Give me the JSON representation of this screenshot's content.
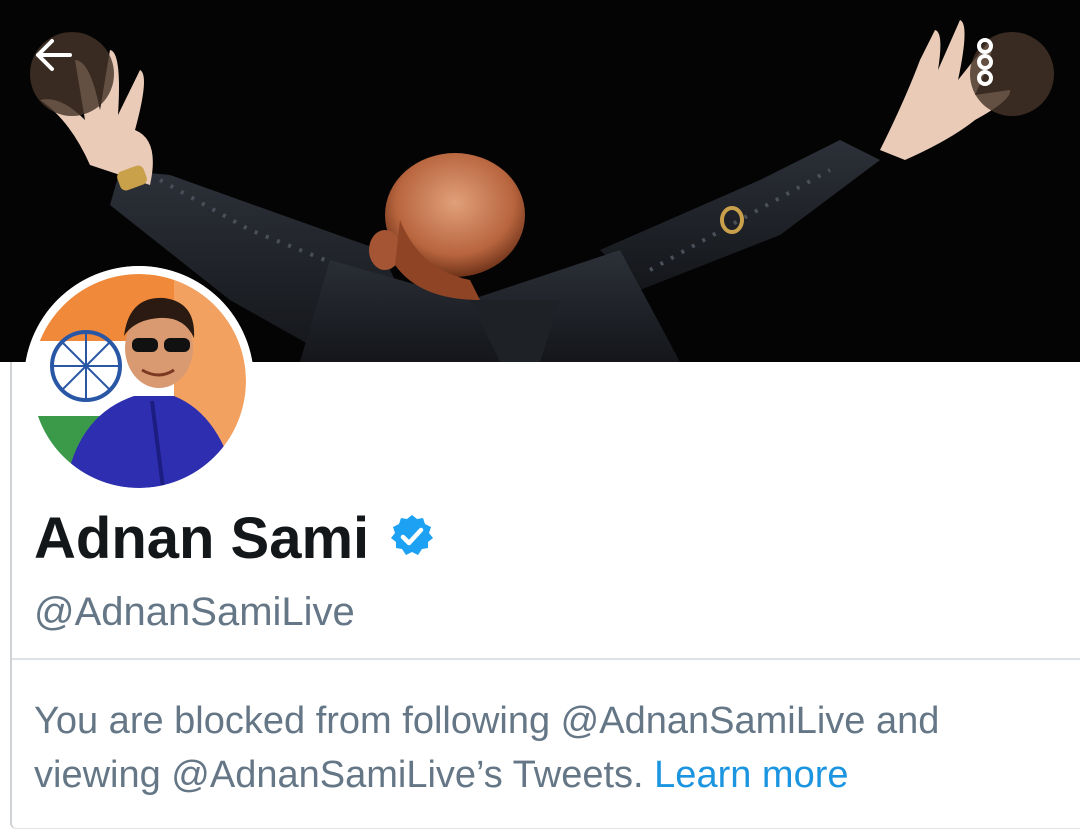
{
  "header": {
    "back_icon": "arrow-left-icon",
    "more_icon": "vertical-ellipsis-icon",
    "nav_button_color": "#46342a"
  },
  "profile": {
    "name": "Adnan Sami",
    "verified_icon": "verified-badge-icon",
    "verified_color": "#1da1f2",
    "handle": "@AdnanSamiLive"
  },
  "blocked_notice": {
    "text": "You are blocked from following @AdnanSamiLive and viewing @AdnanSamiLive’s Tweets.",
    "link_label": "Learn more",
    "text_color": "#657786",
    "link_color": "#1b95e0"
  }
}
